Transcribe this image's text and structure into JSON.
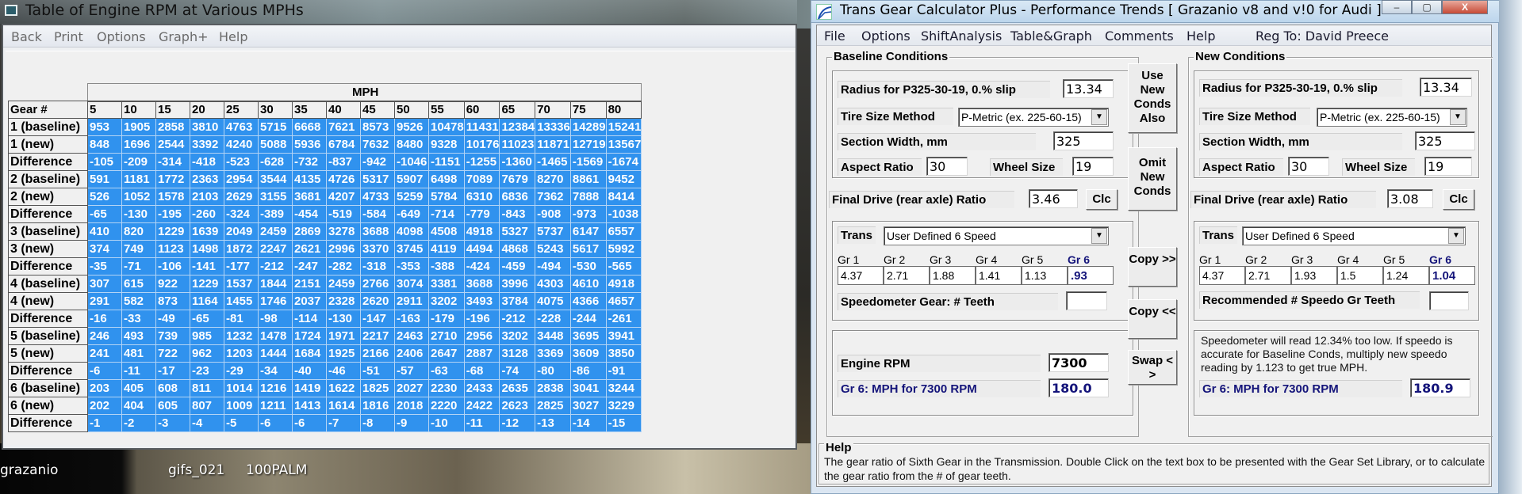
{
  "desktop": {
    "icons": [
      "grazanio",
      "gifs_021",
      "100PALM"
    ]
  },
  "rpm_window": {
    "title": "Table of Engine RPM at Various MPHs",
    "menu": [
      "Back",
      "Print",
      "Options",
      "Graph+",
      "Help"
    ],
    "table": {
      "group_header": "MPH",
      "corner_label": "Gear #",
      "mph_columns": [
        "5",
        "10",
        "15",
        "20",
        "25",
        "30",
        "35",
        "40",
        "45",
        "50",
        "55",
        "60",
        "65",
        "70",
        "75",
        "80"
      ],
      "rows": [
        {
          "label": "1 (baseline)",
          "values": [
            "953",
            "1905",
            "2858",
            "3810",
            "4763",
            "5715",
            "6668",
            "7621",
            "8573",
            "9526",
            "10478",
            "11431",
            "12384",
            "13336",
            "14289",
            "15241"
          ]
        },
        {
          "label": "1 (new)",
          "values": [
            "848",
            "1696",
            "2544",
            "3392",
            "4240",
            "5088",
            "5936",
            "6784",
            "7632",
            "8480",
            "9328",
            "10176",
            "11023",
            "11871",
            "12719",
            "13567"
          ]
        },
        {
          "label": "Difference",
          "values": [
            "-105",
            "-209",
            "-314",
            "-418",
            "-523",
            "-628",
            "-732",
            "-837",
            "-942",
            "-1046",
            "-1151",
            "-1255",
            "-1360",
            "-1465",
            "-1569",
            "-1674"
          ]
        },
        {
          "label": "2 (baseline)",
          "values": [
            "591",
            "1181",
            "1772",
            "2363",
            "2954",
            "3544",
            "4135",
            "4726",
            "5317",
            "5907",
            "6498",
            "7089",
            "7679",
            "8270",
            "8861",
            "9452"
          ]
        },
        {
          "label": "2 (new)",
          "values": [
            "526",
            "1052",
            "1578",
            "2103",
            "2629",
            "3155",
            "3681",
            "4207",
            "4733",
            "5259",
            "5784",
            "6310",
            "6836",
            "7362",
            "7888",
            "8414"
          ]
        },
        {
          "label": "Difference",
          "values": [
            "-65",
            "-130",
            "-195",
            "-260",
            "-324",
            "-389",
            "-454",
            "-519",
            "-584",
            "-649",
            "-714",
            "-779",
            "-843",
            "-908",
            "-973",
            "-1038"
          ]
        },
        {
          "label": "3 (baseline)",
          "values": [
            "410",
            "820",
            "1229",
            "1639",
            "2049",
            "2459",
            "2869",
            "3278",
            "3688",
            "4098",
            "4508",
            "4918",
            "5327",
            "5737",
            "6147",
            "6557"
          ]
        },
        {
          "label": "3 (new)",
          "values": [
            "374",
            "749",
            "1123",
            "1498",
            "1872",
            "2247",
            "2621",
            "2996",
            "3370",
            "3745",
            "4119",
            "4494",
            "4868",
            "5243",
            "5617",
            "5992"
          ]
        },
        {
          "label": "Difference",
          "values": [
            "-35",
            "-71",
            "-106",
            "-141",
            "-177",
            "-212",
            "-247",
            "-282",
            "-318",
            "-353",
            "-388",
            "-424",
            "-459",
            "-494",
            "-530",
            "-565"
          ]
        },
        {
          "label": "4 (baseline)",
          "values": [
            "307",
            "615",
            "922",
            "1229",
            "1537",
            "1844",
            "2151",
            "2459",
            "2766",
            "3074",
            "3381",
            "3688",
            "3996",
            "4303",
            "4610",
            "4918"
          ]
        },
        {
          "label": "4 (new)",
          "values": [
            "291",
            "582",
            "873",
            "1164",
            "1455",
            "1746",
            "2037",
            "2328",
            "2620",
            "2911",
            "3202",
            "3493",
            "3784",
            "4075",
            "4366",
            "4657"
          ]
        },
        {
          "label": "Difference",
          "values": [
            "-16",
            "-33",
            "-49",
            "-65",
            "-81",
            "-98",
            "-114",
            "-130",
            "-147",
            "-163",
            "-179",
            "-196",
            "-212",
            "-228",
            "-244",
            "-261"
          ]
        },
        {
          "label": "5 (baseline)",
          "values": [
            "246",
            "493",
            "739",
            "985",
            "1232",
            "1478",
            "1724",
            "1971",
            "2217",
            "2463",
            "2710",
            "2956",
            "3202",
            "3448",
            "3695",
            "3941"
          ]
        },
        {
          "label": "5 (new)",
          "values": [
            "241",
            "481",
            "722",
            "962",
            "1203",
            "1444",
            "1684",
            "1925",
            "2166",
            "2406",
            "2647",
            "2887",
            "3128",
            "3369",
            "3609",
            "3850"
          ]
        },
        {
          "label": "Difference",
          "values": [
            "-6",
            "-11",
            "-17",
            "-23",
            "-29",
            "-34",
            "-40",
            "-46",
            "-51",
            "-57",
            "-63",
            "-68",
            "-74",
            "-80",
            "-86",
            "-91"
          ]
        },
        {
          "label": "6 (baseline)",
          "values": [
            "203",
            "405",
            "608",
            "811",
            "1014",
            "1216",
            "1419",
            "1622",
            "1825",
            "2027",
            "2230",
            "2433",
            "2635",
            "2838",
            "3041",
            "3244"
          ]
        },
        {
          "label": "6 (new)",
          "values": [
            "202",
            "404",
            "605",
            "807",
            "1009",
            "1211",
            "1413",
            "1614",
            "1816",
            "2018",
            "2220",
            "2422",
            "2623",
            "2825",
            "3027",
            "3229"
          ]
        },
        {
          "label": "Difference",
          "values": [
            "-1",
            "-2",
            "-3",
            "-4",
            "-5",
            "-6",
            "-6",
            "-7",
            "-8",
            "-9",
            "-10",
            "-11",
            "-12",
            "-13",
            "-14",
            "-15"
          ]
        }
      ]
    },
    "colors": {
      "cell_bg": "#3092ee",
      "cell_text": "#ffffff"
    }
  },
  "calc_window": {
    "title": "Trans Gear Calculator Plus - Performance Trends    [ Grazanio v8 and v!0 for Audi ]",
    "caption_buttons": {
      "minimize": "–",
      "maximize": "▢",
      "close": "X"
    },
    "menu": [
      "File",
      "Options",
      "ShiftAnalysis",
      "Table&Graph",
      "Comments",
      "Help"
    ],
    "reg_to": "Reg To: David Preece",
    "baseline": {
      "title": "Baseline Conditions",
      "radius_label": "Radius for P325-30-19, 0.% slip",
      "radius_value": "13.34",
      "tire_method_label": "Tire Size Method",
      "tire_method_value": "P-Metric (ex. 225-60-15)",
      "section_width_label": "Section Width, mm",
      "section_width_value": "325",
      "aspect_label": "Aspect Ratio",
      "aspect_value": "30",
      "wheel_label": "Wheel Size",
      "wheel_value": "19",
      "final_drive_label": "Final Drive (rear axle) Ratio",
      "final_drive_value": "3.46",
      "clc_label": "Clc",
      "trans_label": "Trans",
      "trans_value": "User Defined 6 Speed",
      "gear_labels": [
        "Gr 1",
        "Gr 2",
        "Gr 3",
        "Gr 4",
        "Gr 5",
        "Gr 6"
      ],
      "gear_values": [
        "4.37",
        "2.71",
        "1.88",
        "1.41",
        "1.13",
        ".93"
      ],
      "speedo_label": "Speedometer Gear: # Teeth",
      "speedo_value": "",
      "rpm_label": "Engine RPM",
      "rpm_value": "7300",
      "mph_label": "Gr 6: MPH for 7300 RPM",
      "mph_value": "180.0"
    },
    "new": {
      "title": "New Conditions",
      "radius_label": "Radius for P325-30-19, 0.% slip",
      "radius_value": "13.34",
      "tire_method_label": "Tire Size Method",
      "tire_method_value": "P-Metric (ex. 225-60-15)",
      "section_width_label": "Section Width, mm",
      "section_width_value": "325",
      "aspect_label": "Aspect Ratio",
      "aspect_value": "30",
      "wheel_label": "Wheel Size",
      "wheel_value": "19",
      "final_drive_label": "Final Drive (rear axle) Ratio",
      "final_drive_value": "3.08",
      "clc_label": "Clc",
      "trans_label": "Trans",
      "trans_value": "User Defined 6 Speed",
      "gear_labels": [
        "Gr 1",
        "Gr 2",
        "Gr 3",
        "Gr 4",
        "Gr 5",
        "Gr 6"
      ],
      "gear_values": [
        "4.37",
        "2.71",
        "1.93",
        "1.5",
        "1.24",
        "1.04"
      ],
      "speedo_label": "Recommended # Speedo Gr Teeth",
      "speedo_value": "",
      "speedo_note": "Speedometer will read 12.34% too low. If speedo is accurate for Baseline Conds, multiply new speedo reading by 1.123 to get true MPH.",
      "mph_label": "Gr 6: MPH for 7300 RPM",
      "mph_value": "180.9"
    },
    "middle_buttons": {
      "use_new": "Use New Conds Also",
      "omit_new": "Omit New Conds",
      "copy_right": "Copy >>",
      "copy_left": "Copy <<",
      "swap": "Swap < >"
    },
    "help": {
      "title": "Help",
      "text": "The gear ratio of Sixth Gear in the Transmission.  Double Click on the text box to be presented with the Gear Set Library, or to calculate the gear ratio from the # of gear teeth."
    }
  }
}
